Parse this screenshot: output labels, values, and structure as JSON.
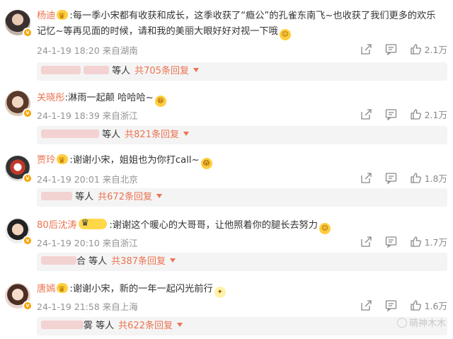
{
  "comments": [
    {
      "username": "杨迪",
      "text_line1": ":每一季小宋都有收获和成长，这季收获了“瘾公”的孔雀东南飞~也收获了我们更多的欢乐",
      "text_line2": "记忆~等再见面的时候，请和我的美丽大眼好好对视一下哦",
      "time": "24-1-19 18:20",
      "location": "来自湖南",
      "likes": "2.1万",
      "reply_people": "等人",
      "reply_count": "共705条回复"
    },
    {
      "username": "关晓彤",
      "text_line1": ":淋雨一起颠 哈哈哈~",
      "time": "24-1-19 18:39",
      "location": "来自浙江",
      "likes": "2.1万",
      "reply_people": "等人",
      "reply_count": "共821条回复"
    },
    {
      "username": "贾玲",
      "text_line1": ":谢谢小宋，姐姐也为你打call~",
      "time": "24-1-19 20:01",
      "location": "来自北京",
      "likes": "1.8万",
      "reply_people": "等人",
      "reply_count": "共672条回复"
    },
    {
      "username": "80后沈涛",
      "text_line1": ":谢谢这个暖心的大哥哥，让他照着你的腿长去努力",
      "time": "24-1-19 20:10",
      "location": "来自浙江",
      "likes": "1.7万",
      "reply_prefix": "合",
      "reply_people": "等人",
      "reply_count": "共387条回复"
    },
    {
      "username": "唐嫣",
      "text_line1": ":谢谢小宋，新的一年一起闪光前行",
      "time": "24-1-19 21:58",
      "location": "来自上海",
      "likes": "1.6万",
      "reply_prefix": "雾",
      "reply_people": "等人",
      "reply_count": "共622条回复"
    }
  ],
  "watermark": "萌神木木",
  "icons": {
    "share": "share-icon",
    "comment": "comment-icon",
    "like": "thumbs-up-icon",
    "verified": "verified-badge-icon",
    "crown": "crown-badge-icon"
  },
  "colors": {
    "username": "#eb7350",
    "meta": "#939393",
    "reply_bg": "#f4f4f4"
  }
}
